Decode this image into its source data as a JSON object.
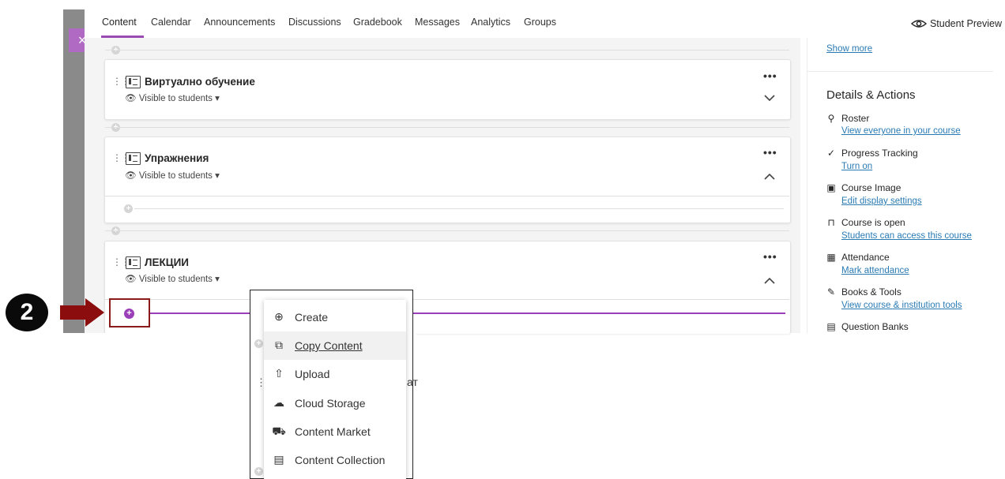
{
  "nav": {
    "tabs": [
      {
        "label": "Content"
      },
      {
        "label": "Calendar"
      },
      {
        "label": "Announcements"
      },
      {
        "label": "Discussions"
      },
      {
        "label": "Gradebook"
      },
      {
        "label": "Messages"
      },
      {
        "label": "Analytics"
      },
      {
        "label": "Groups"
      }
    ],
    "student_preview": "Student Preview",
    "close_glyph": "×"
  },
  "content": {
    "folders": [
      {
        "title": "Виртуално обучение",
        "visibility": "Visible to students",
        "expanded": false
      },
      {
        "title": "Упражнения",
        "visibility": "Visible to students",
        "expanded": true
      },
      {
        "title": "ЛЕКЦИИ",
        "visibility": "Visible to students",
        "expanded": true
      }
    ],
    "more_glyph": "•••",
    "partial_text": "ат"
  },
  "annotation": {
    "step": "2"
  },
  "menu": {
    "items": [
      {
        "label": "Create",
        "icon": "plus-circle-icon",
        "glyph": "⊕"
      },
      {
        "label": "Copy Content",
        "icon": "copy-icon",
        "glyph": "⧉"
      },
      {
        "label": "Upload",
        "icon": "upload-icon",
        "glyph": "⇧"
      },
      {
        "label": "Cloud Storage",
        "icon": "cloud-icon",
        "glyph": "☁"
      },
      {
        "label": "Content Market",
        "icon": "cart-icon",
        "glyph": "⛟"
      },
      {
        "label": "Content Collection",
        "icon": "collection-icon",
        "glyph": "▤"
      }
    ]
  },
  "details": {
    "show_more": "Show more",
    "title": "Details & Actions",
    "items": [
      {
        "label": "Roster",
        "link": "View everyone in your course",
        "icon": "roster-icon"
      },
      {
        "label": "Progress Tracking",
        "link": "Turn on",
        "icon": "progress-icon"
      },
      {
        "label": "Course Image",
        "link": "Edit display settings",
        "icon": "image-icon"
      },
      {
        "label": "Course is open",
        "link": "Students can access this course",
        "icon": "unlock-icon"
      },
      {
        "label": "Attendance",
        "link": "Mark attendance",
        "icon": "attendance-icon"
      },
      {
        "label": "Books & Tools",
        "link": "View course & institution tools",
        "icon": "tools-icon"
      },
      {
        "label": "Question Banks",
        "link": "",
        "icon": "question-bank-icon"
      }
    ]
  },
  "colors": {
    "accent": "#9a3fb8",
    "link": "#2a7bb4",
    "annotation": "#8b0d0d"
  }
}
